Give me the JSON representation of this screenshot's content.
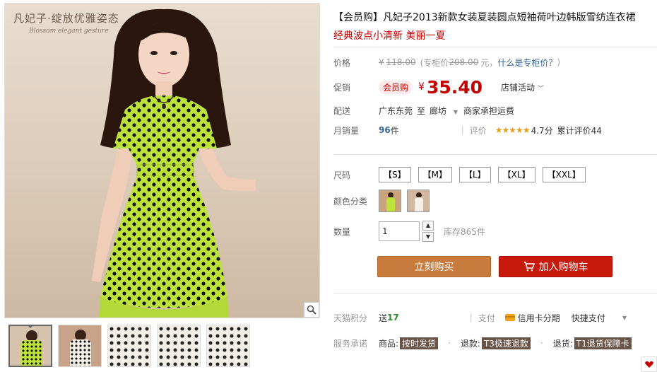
{
  "gallery": {
    "brand_cn": "凡妃子·绽放优雅姿态",
    "brand_en": "Blossom elegant gesture",
    "zoom_icon": "magnifier-icon",
    "thumbnails": [
      "thumb-green-dress-front",
      "thumb-white-dress-model",
      "thumb-fabric-detail-1",
      "thumb-fabric-detail-2",
      "thumb-fabric-detail-3"
    ]
  },
  "product": {
    "title": "【会员购】凡妃子2013新款女装夏装圆点短袖荷叶边韩版雪纺连衣裙",
    "subtitle": "经典波点小清新 美丽一夏"
  },
  "price": {
    "label": "价格",
    "currency": "¥",
    "original": "118.00",
    "counter_prefix": "(专柜价",
    "counter_value": "208.00",
    "counter_suffix": "元，",
    "counter_link": "什么是专柜价？",
    "counter_close": ")"
  },
  "promo": {
    "label": "促销",
    "tag": "会员购",
    "currency": "¥",
    "price": "35.40",
    "activity": "店铺活动"
  },
  "delivery": {
    "label": "配送",
    "from": "广东东莞",
    "to_word": "至",
    "dest": "廊坊",
    "fee": "商家承担运费"
  },
  "sales": {
    "label": "月销量",
    "count": "96",
    "unit": "件",
    "rating_label": "评价",
    "stars": "★★★★★",
    "score": "4.7分",
    "total": "累计评价44"
  },
  "sizes": {
    "label": "尺码",
    "options": [
      "【S】",
      "【M】",
      "【L】",
      "【XL】",
      "【XXL】"
    ]
  },
  "colors": {
    "label": "颜色分类"
  },
  "quantity": {
    "label": "数量",
    "value": "1",
    "stock": "库存865件",
    "up": "▲",
    "down": "▼"
  },
  "actions": {
    "buy_now": "立刻购买",
    "add_cart": "加入购物车"
  },
  "points": {
    "label": "天猫积分",
    "prefix": "送",
    "value": "17",
    "pay_label": "支付",
    "credit": "信用卡分期",
    "fast": "快捷支付"
  },
  "service": {
    "label": "服务承诺",
    "goods": "商品:",
    "goods_tag": "按时发货",
    "refund": "退款:",
    "refund_tag": "T3极速退款",
    "return": "退货:",
    "return_tag": "T1退货保障卡"
  },
  "colors_theme": {
    "accent_red": "#c40000",
    "buy_orange": "#c77c3e",
    "cart_red": "#c81a0c"
  }
}
